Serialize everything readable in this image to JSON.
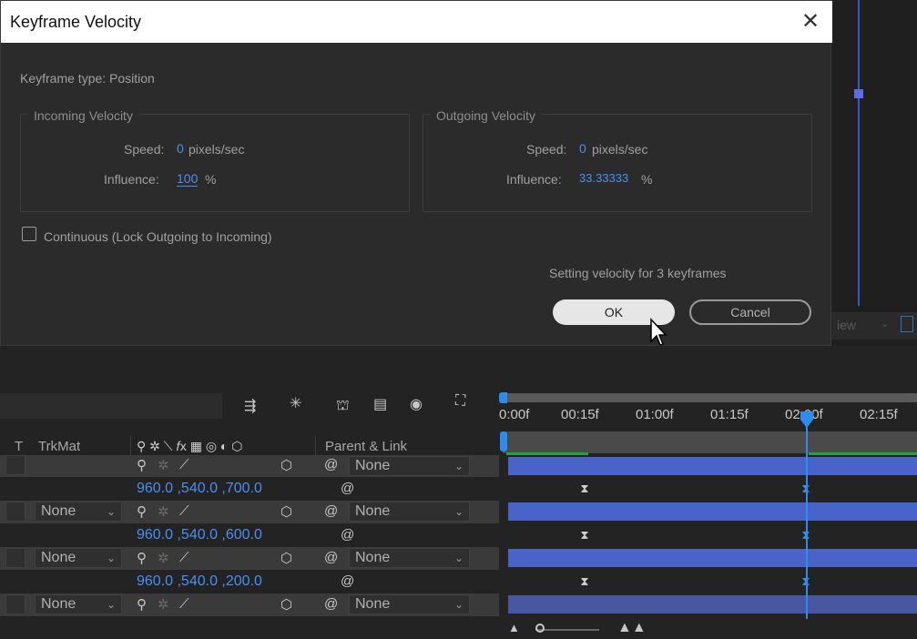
{
  "dialog": {
    "title": "Keyframe Velocity",
    "keyframe_type": "Keyframe type: Position",
    "incoming": {
      "title": "Incoming Velocity",
      "speed_label": "Speed:",
      "speed_value": "0",
      "speed_unit": "pixels/sec",
      "influence_label": "Influence:",
      "influence_value": "100",
      "influence_unit": "%"
    },
    "outgoing": {
      "title": "Outgoing Velocity",
      "speed_label": "Speed:",
      "speed_value": "0",
      "speed_unit": "pixels/sec",
      "influence_label": "Influence:",
      "influence_value": "33.33333",
      "influence_unit": "%"
    },
    "continuous_label": "Continuous (Lock Outgoing to Incoming)",
    "continuous_checked": false,
    "status": "Setting velocity for 3 keyframes",
    "ok": "OK",
    "cancel": "Cancel"
  },
  "background_panel": {
    "view_label": "iew"
  },
  "columns": {
    "t": "T",
    "trkmat": "TrkMat",
    "parent": "Parent & Link"
  },
  "rows": [
    {
      "type": "layer",
      "trkmat": "",
      "parent": "None"
    },
    {
      "type": "prop",
      "value": "960.0 ,540.0 ,700.0"
    },
    {
      "type": "layer",
      "trkmat": "None",
      "parent": "None"
    },
    {
      "type": "prop",
      "value": "960.0 ,540.0 ,600.0"
    },
    {
      "type": "layer",
      "trkmat": "None",
      "parent": "None"
    },
    {
      "type": "prop",
      "value": "960.0 ,540.0 ,200.0"
    },
    {
      "type": "layer",
      "trkmat": "None",
      "parent": "None"
    }
  ],
  "ruler": {
    "ticks": [
      "0:00f",
      "00:15f",
      "01:00f",
      "01:15f",
      "02:00f",
      "02:15f"
    ]
  },
  "accent_color": "#2d8cf0",
  "layer_bar_color": "#4a63c8",
  "keyframe_color_selected": "#3a90f0"
}
